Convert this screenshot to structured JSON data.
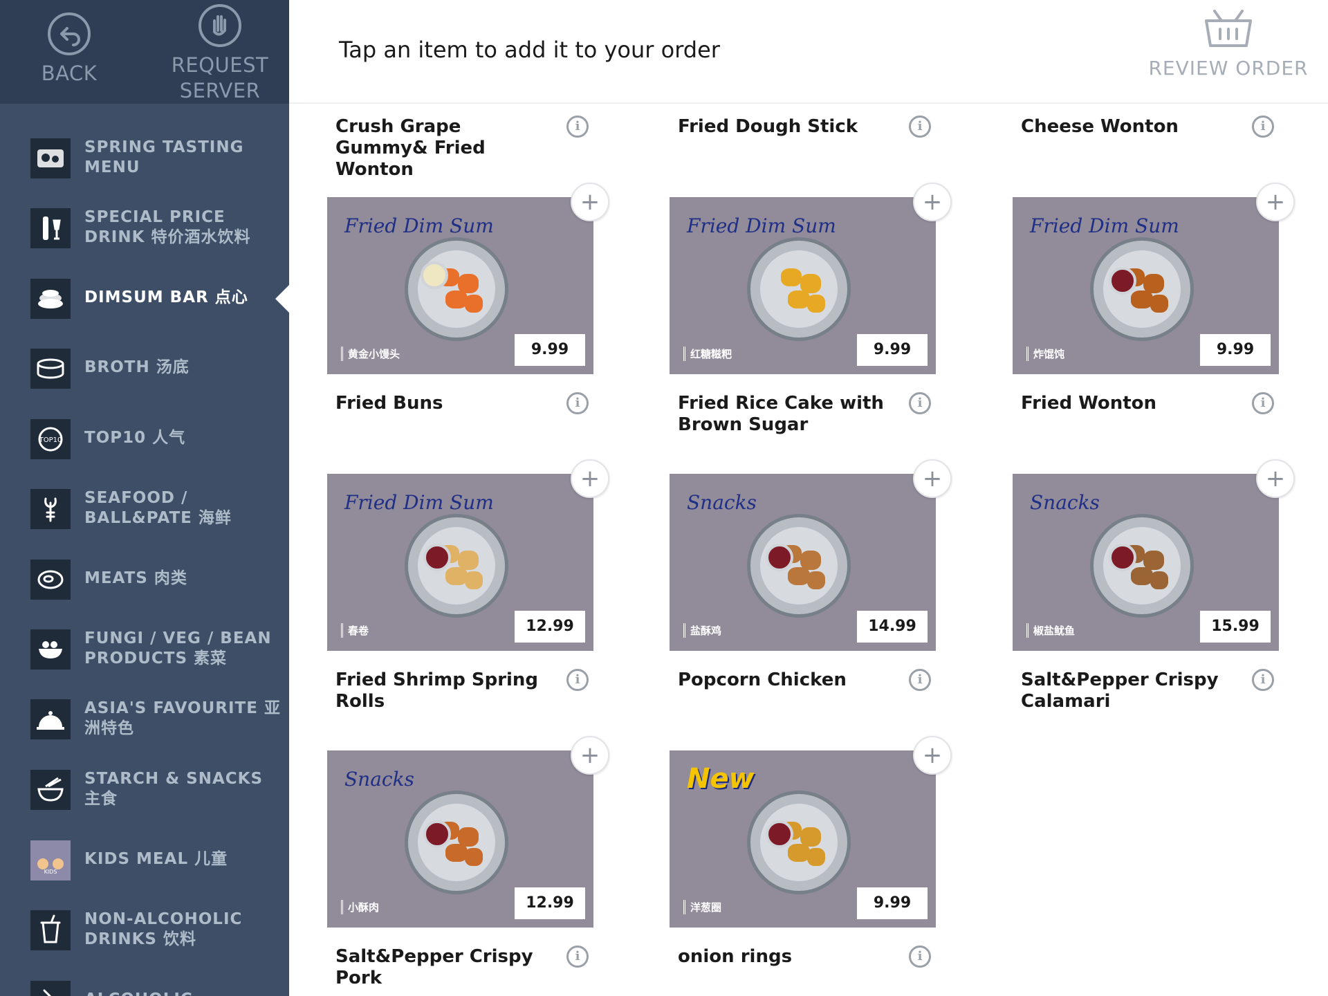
{
  "top_buttons": {
    "back": "BACK",
    "request_server": "REQUEST SERVER"
  },
  "header": {
    "instruction": "Tap an item to add it to your order",
    "review_order": "REVIEW ORDER"
  },
  "categories": [
    {
      "label": "SPRING TASTING MENU",
      "icon": "tasting-menu-icon",
      "active": false
    },
    {
      "label": "SPECIAL PRICE DRINK 特价酒水饮料",
      "icon": "wine-bottle-icon",
      "active": false
    },
    {
      "label": "DIMSUM BAR 点心",
      "icon": "dimsum-icon",
      "active": true
    },
    {
      "label": "BROTH 汤底",
      "icon": "broth-pot-icon",
      "active": false
    },
    {
      "label": "TOP10 人气",
      "icon": "top10-icon",
      "active": false
    },
    {
      "label": "SEAFOOD / BALL&PATE 海鲜",
      "icon": "lobster-icon",
      "active": false
    },
    {
      "label": "MEATS 肉类",
      "icon": "meat-icon",
      "active": false
    },
    {
      "label": "FUNGI / VEG / BEAN PRODUCTS 素菜",
      "icon": "vegetable-icon",
      "active": false
    },
    {
      "label": "ASIA'S FAVOURITE 亚洲特色",
      "icon": "cloche-icon",
      "active": false
    },
    {
      "label": "STARCH & SNACKS 主食",
      "icon": "noodle-bowl-icon",
      "active": false
    },
    {
      "label": "KIDS MEAL 儿童",
      "icon": "kids-meal-icon",
      "active": false
    },
    {
      "label": "NON-ALCOHOLIC DRINKS 饮料",
      "icon": "cup-icon",
      "active": false
    },
    {
      "label": "ALCOHOLIC",
      "icon": "glass-icon",
      "active": false
    }
  ],
  "top_row": [
    {
      "name": "Crush Grape Gummy& Fried Wonton"
    },
    {
      "name": "Fried Dough Stick"
    },
    {
      "name": "Cheese Wonton"
    }
  ],
  "items": [
    {
      "name": "Fried Buns",
      "price": "9.99",
      "tag": "Fried Dim Sum",
      "sub": "黄金小馒头",
      "new": false
    },
    {
      "name": "Fried Rice Cake with Brown Sugar",
      "price": "9.99",
      "tag": "Fried Dim Sum",
      "sub": "红糖糍粑",
      "new": false
    },
    {
      "name": "Fried Wonton",
      "price": "9.99",
      "tag": "Fried Dim Sum",
      "sub": "炸馄饨",
      "new": false
    },
    {
      "name": "Fried Shrimp Spring Rolls",
      "price": "12.99",
      "tag": "Fried Dim Sum",
      "sub": "春卷",
      "new": false
    },
    {
      "name": "Popcorn Chicken",
      "price": "14.99",
      "tag": "Snacks",
      "sub": "盐酥鸡",
      "new": false
    },
    {
      "name": "Salt&Pepper Crispy Calamari",
      "price": "15.99",
      "tag": "Snacks",
      "sub": "椒盐鱿鱼",
      "new": false
    },
    {
      "name": "Salt&Pepper Crispy Pork",
      "price": "12.99",
      "tag": "Snacks",
      "sub": "小酥肉",
      "new": false
    },
    {
      "name": "onion rings",
      "price": "9.99",
      "tag": "New",
      "sub": "洋葱圈",
      "new": true
    }
  ],
  "colors": {
    "sidebar": "#3d4e66",
    "sidebar_top": "#2f3e54",
    "card_bg": "#918b9a",
    "active_label": "#ffffff",
    "inactive_label": "#aebbc9"
  }
}
